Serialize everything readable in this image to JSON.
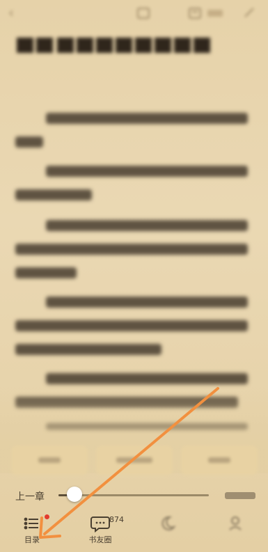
{
  "topbar": {
    "back_icon": "chevron-left-icon",
    "action_1": "",
    "action_2": ""
  },
  "chapter": {
    "title": "",
    "paragraphs": [
      "",
      "",
      "",
      "",
      "",
      ""
    ]
  },
  "reading_buttons": [
    "",
    "",
    ""
  ],
  "progress": {
    "prev_label": "上一章",
    "next_label": "",
    "value": 0.08
  },
  "bottom_nav": {
    "toc_label": "目录",
    "book_friends_label": "书友圈",
    "book_friends_count": "874",
    "night_label": "",
    "settings_label": ""
  },
  "annotation": {
    "arrow_color": "#f2903f"
  },
  "colors": {
    "background": "#e9d7b0",
    "text": "#3d3326",
    "accent_red": "#e23b2e"
  }
}
